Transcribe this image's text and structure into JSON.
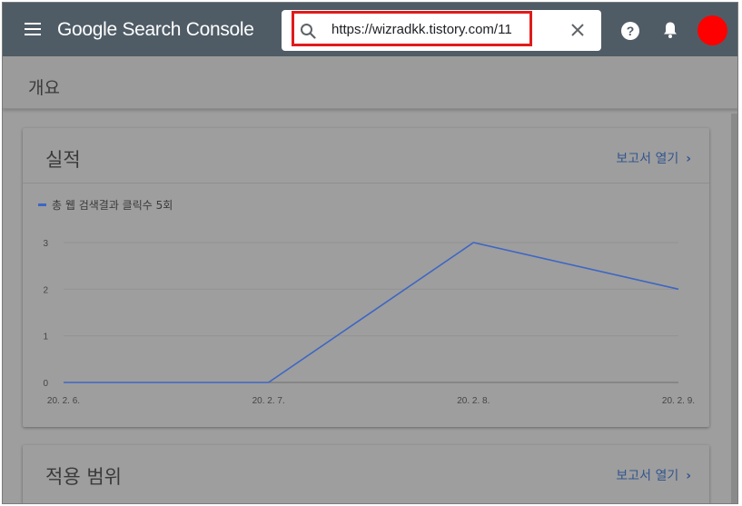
{
  "header": {
    "app_title": "Google Search Console",
    "search_value": "https://wizradkk.tistory.com/11",
    "avatar_color": "#ff0000",
    "header_bg": "#4f5c66"
  },
  "page": {
    "title": "개요"
  },
  "performance_card": {
    "title": "실적",
    "link_label": "보고서 열기",
    "legend_label": "총 웹 검색결과 클릭수 5회"
  },
  "scope_card": {
    "title": "적용 범위",
    "link_label": "보고서 열기"
  },
  "chart_data": {
    "type": "line",
    "categories": [
      "20. 2. 6.",
      "20. 2. 7.",
      "20. 2. 8.",
      "20. 2. 9."
    ],
    "series": [
      {
        "name": "총 웹 검색결과 클릭수 5회",
        "values": [
          0,
          0,
          3,
          2
        ],
        "color": "#3e66c4"
      }
    ],
    "yticks": [
      0,
      1,
      2,
      3
    ],
    "ylim": [
      0,
      3
    ],
    "grid": true,
    "legend": "top-left"
  }
}
